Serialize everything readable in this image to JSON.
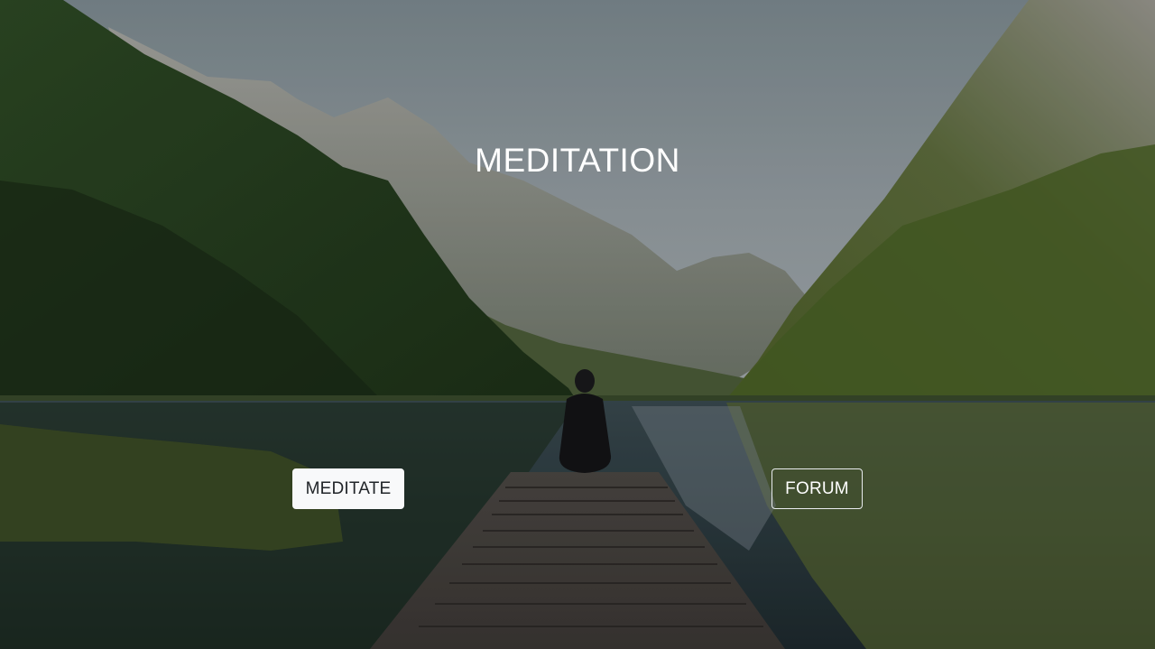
{
  "hero": {
    "title": "MEDITATION",
    "background_image": "mountain-lake-dock-with-seated-meditator"
  },
  "actions": {
    "meditate_label": "MEDITATE",
    "forum_label": "FORUM"
  },
  "colors": {
    "title_text": "#ffffff",
    "primary_button_bg": "#f8f9fa",
    "primary_button_text": "#212529",
    "outline_button_border": "#e9ecef",
    "outline_button_text": "#ffffff"
  }
}
